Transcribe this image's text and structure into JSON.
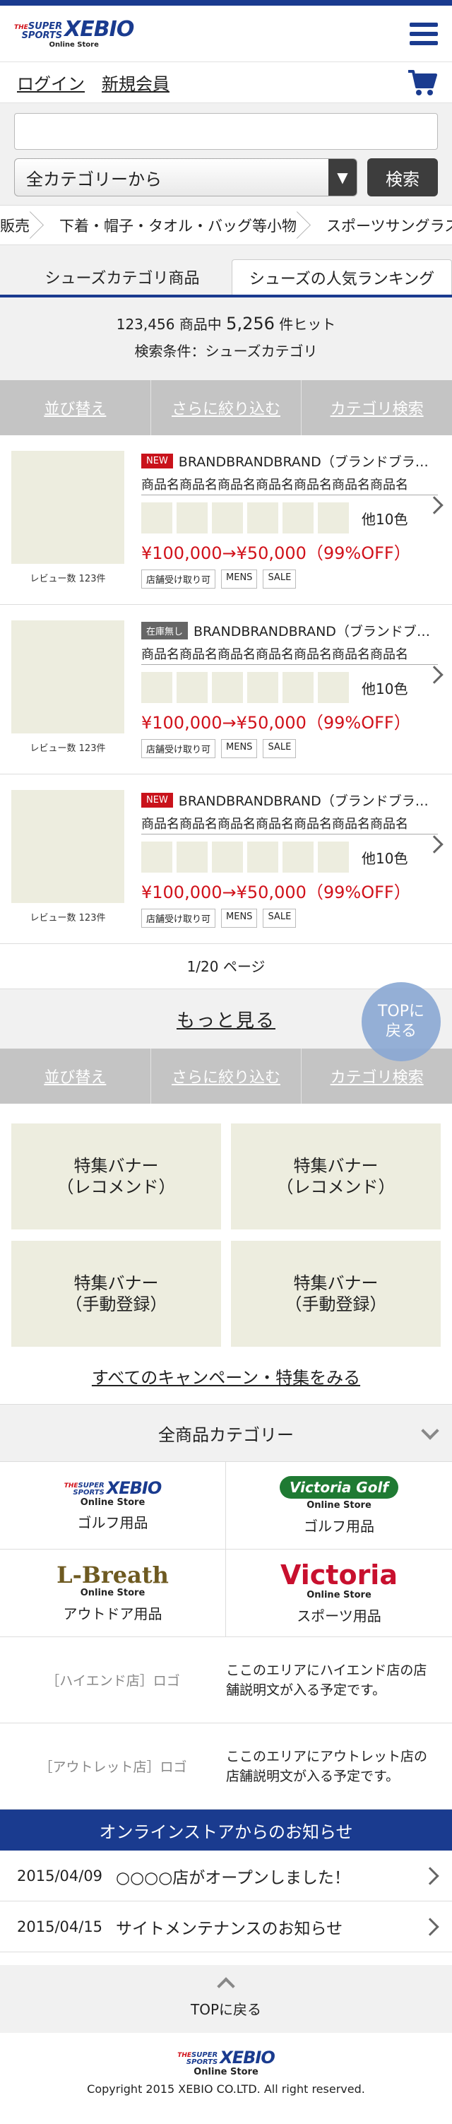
{
  "header": {
    "logo_the": "THE",
    "logo_super": "SUPER",
    "logo_sports": "SPORTS",
    "logo_brand": "XEBIO",
    "logo_sub": "Online Store",
    "menu_icon": "hamburger-icon",
    "cart_icon": "cart-icon"
  },
  "auth": {
    "login": "ログイン",
    "register": "新規会員"
  },
  "search": {
    "placeholder": "",
    "category": "全カテゴリーから",
    "button": "検索"
  },
  "breadcrumb": [
    "販売",
    "下着・帽子・タオル・バッグ等小物",
    "スポーツサングラス"
  ],
  "tabs": [
    "シューズカテゴリ商品",
    "シューズの人気ランキング"
  ],
  "results": {
    "total": "123,456",
    "total_suffix": "商品中",
    "hits": "5,256",
    "hits_suffix": "件ヒット",
    "condition": "検索条件：シューズカテゴリ"
  },
  "filters": [
    "並び替え",
    "さらに絞り込む",
    "カテゴリ検索"
  ],
  "products": [
    {
      "badge": "NEW",
      "brand": "BRANDBRANDBRAND（ブランドブランドブランド）",
      "name": "商品名商品名商品名商品名商品名商品名商品名",
      "colors": "他10色",
      "price": "¥100,000→¥50,000（99%OFF）",
      "tags": [
        "店舗受け取り可",
        "MENS",
        "SALE"
      ],
      "reviews": "レビュー数 123件"
    },
    {
      "badge": "在庫無し",
      "brand": "BRANDBRANDBRAND（ブランドブランドブランド）",
      "name": "商品名商品名商品名商品名商品名商品名商品名",
      "colors": "他10色",
      "price": "¥100,000→¥50,000（99%OFF）",
      "tags": [
        "店舗受け取り可",
        "MENS",
        "SALE"
      ],
      "reviews": "レビュー数 123件"
    },
    {
      "badge": "NEW",
      "brand": "BRANDBRANDBRAND（ブランドブランドブランド）",
      "name": "商品名商品名商品名商品名商品名商品名商品名",
      "colors": "他10色",
      "price": "¥100,000→¥50,000（99%OFF）",
      "tags": [
        "店舗受け取り可",
        "MENS",
        "SALE"
      ],
      "reviews": "レビュー数 123件"
    }
  ],
  "pager": "1/20 ページ",
  "to_top_floating": [
    "TOPに",
    "戻る"
  ],
  "more": "もっと見る",
  "banners": [
    [
      "特集バナー",
      "（レコメンド）"
    ],
    [
      "特集バナー",
      "（レコメンド）"
    ],
    [
      "特集バナー",
      "（手動登録）"
    ],
    [
      "特集バナー",
      "（手動登録）"
    ]
  ],
  "all_campaigns": "すべてのキャンペーン・特集をみる",
  "category_header": "全商品カテゴリー",
  "stores": [
    {
      "logo": "XEBIO",
      "sub": "Online Store",
      "caption": "ゴルフ用品"
    },
    {
      "logo": "Victoria Golf",
      "sub": "Online Store",
      "caption": "ゴルフ用品"
    },
    {
      "logo": "L-Breath",
      "sub": "Online Store",
      "caption": "アウトドア用品"
    },
    {
      "logo": "Victoria",
      "sub": "Online Store",
      "caption": "スポーツ用品"
    }
  ],
  "ext_stores": [
    {
      "logo": "［ハイエンド店］ロゴ",
      "desc": "ここのエリアにハイエンド店の店舗説明文が入る予定です。"
    },
    {
      "logo": "［アウトレット店］ロゴ",
      "desc": "ここのエリアにアウトレット店の店舗説明文が入る予定です。"
    }
  ],
  "notices_header": "オンラインストアからのお知らせ",
  "notices": [
    {
      "date": "2015/04/09",
      "text": "○○○○店がオープンしました！"
    },
    {
      "date": "2015/04/15",
      "text": "サイトメンテナンスのお知らせ"
    }
  ],
  "to_top": "TOPに戻る",
  "copyright": "Copyright 2015 XEBIO CO.LTD. All right reserved.",
  "colors": {
    "brand_blue": "#1a3b8f",
    "sale_red": "#d1111a",
    "bg_gray": "#f1f1f1"
  }
}
